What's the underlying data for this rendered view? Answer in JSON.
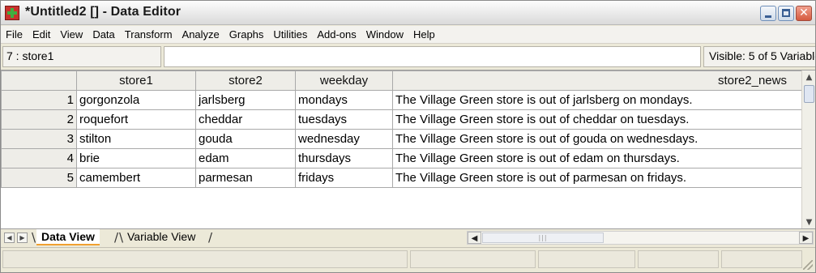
{
  "window": {
    "title": "*Untitled2 [] - Data Editor",
    "icon": "spss-data-icon"
  },
  "menu": {
    "items": [
      "File",
      "Edit",
      "View",
      "Data",
      "Transform",
      "Analyze",
      "Graphs",
      "Utilities",
      "Add-ons",
      "Window",
      "Help"
    ]
  },
  "editor": {
    "cell_ref": "7 : store1",
    "cell_value": "",
    "visible": "Visible: 5 of 5 Variables"
  },
  "grid": {
    "columns": [
      "store1",
      "store2",
      "weekday",
      "store2_news"
    ],
    "rows": [
      {
        "num": "1",
        "store1": "gorgonzola",
        "store2": "jarlsberg",
        "weekday": "mondays",
        "store2_news": "The Village Green store is out of jarlsberg on mondays."
      },
      {
        "num": "2",
        "store1": "roquefort",
        "store2": "cheddar",
        "weekday": "tuesdays",
        "store2_news": "The Village Green store is out of cheddar on tuesdays."
      },
      {
        "num": "3",
        "store1": "stilton",
        "store2": "gouda",
        "weekday": "wednesday",
        "store2_news": "The Village Green store is out of gouda on wednesdays."
      },
      {
        "num": "4",
        "store1": "brie",
        "store2": "edam",
        "weekday": "thursdays",
        "store2_news": "The Village Green store is out of edam on thursdays."
      },
      {
        "num": "5",
        "store1": "camembert",
        "store2": "parmesan",
        "weekday": "fridays",
        "store2_news": "The Village Green store is out of parmesan on fridays."
      }
    ]
  },
  "tabs": {
    "data_view": "Data View",
    "variable_view": "Variable View"
  },
  "colors": {
    "window_bg": "#ece9d8",
    "header_bg": "#eeede8",
    "active_tab_underline": "#f0a030"
  }
}
